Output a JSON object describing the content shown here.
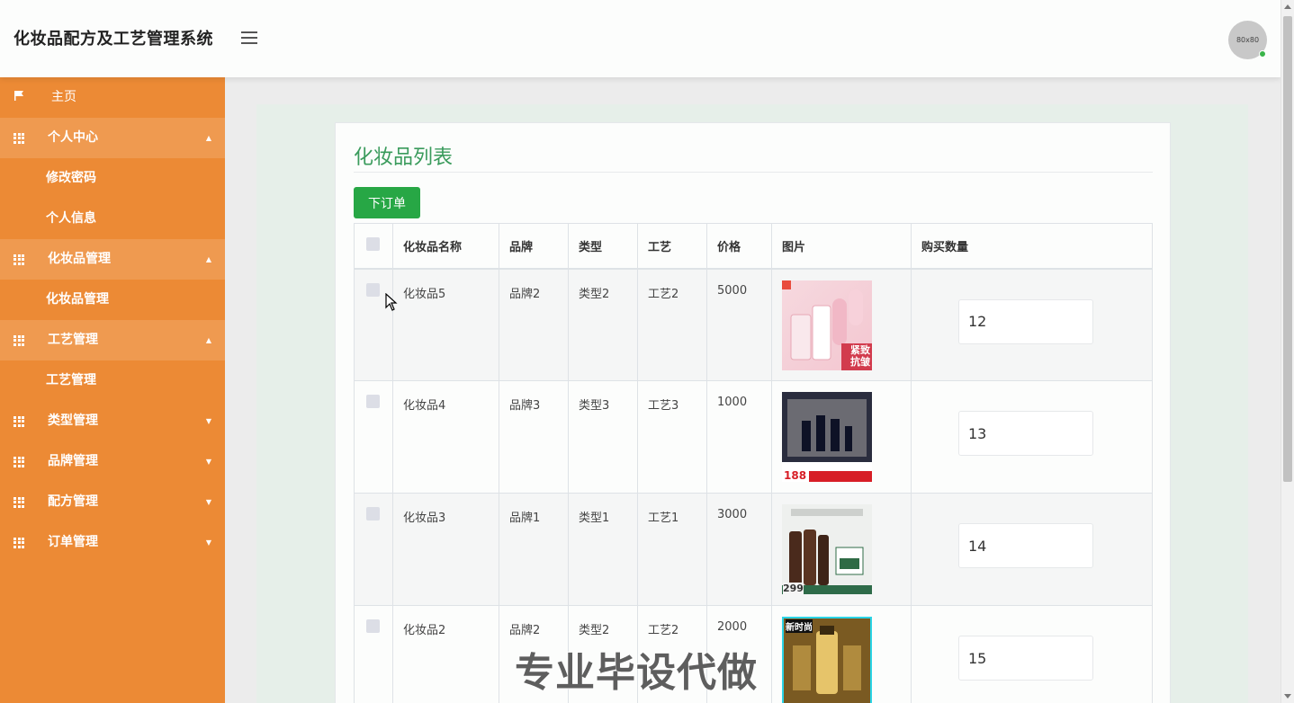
{
  "header": {
    "title": "化妆品配方及工艺管理系统",
    "avatar_text": "80x80"
  },
  "sidebar": {
    "items": [
      {
        "label": "主页",
        "type": "home"
      },
      {
        "label": "个人中心",
        "type": "parent",
        "open": true
      },
      {
        "label": "修改密码",
        "type": "sub"
      },
      {
        "label": "个人信息",
        "type": "sub"
      },
      {
        "label": "化妆品管理",
        "type": "parent",
        "open": true
      },
      {
        "label": "化妆品管理",
        "type": "sub"
      },
      {
        "label": "工艺管理",
        "type": "parent",
        "open": true
      },
      {
        "label": "工艺管理",
        "type": "sub"
      },
      {
        "label": "类型管理",
        "type": "parent",
        "open": false
      },
      {
        "label": "品牌管理",
        "type": "parent",
        "open": false
      },
      {
        "label": "配方管理",
        "type": "parent",
        "open": false
      },
      {
        "label": "订单管理",
        "type": "parent",
        "open": false
      }
    ]
  },
  "main": {
    "title": "化妆品列表",
    "order_button": "下订单",
    "columns": [
      "化妆品名称",
      "品牌",
      "类型",
      "工艺",
      "价格",
      "图片",
      "购买数量"
    ],
    "rows": [
      {
        "name": "化妆品5",
        "brand": "品牌2",
        "type": "类型2",
        "craft": "工艺2",
        "price": "5000",
        "qty": "12",
        "thumb_text": "紧致\n抗皱"
      },
      {
        "name": "化妆品4",
        "brand": "品牌3",
        "type": "类型3",
        "craft": "工艺3",
        "price": "1000",
        "qty": "13",
        "thumb_text": "188"
      },
      {
        "name": "化妆品3",
        "brand": "品牌1",
        "type": "类型1",
        "craft": "工艺1",
        "price": "3000",
        "qty": "14",
        "thumb_text": "299"
      },
      {
        "name": "化妆品2",
        "brand": "品牌2",
        "type": "类型2",
        "craft": "工艺2",
        "price": "2000",
        "qty": "15",
        "thumb_text": "新时尚"
      }
    ]
  },
  "watermark": "专业毕设代做",
  "colors": {
    "sidebar": "#ec8a35",
    "sidebar_open": "#ef9a50",
    "accent_green": "#27a745",
    "title_green": "#3a9b5c"
  }
}
